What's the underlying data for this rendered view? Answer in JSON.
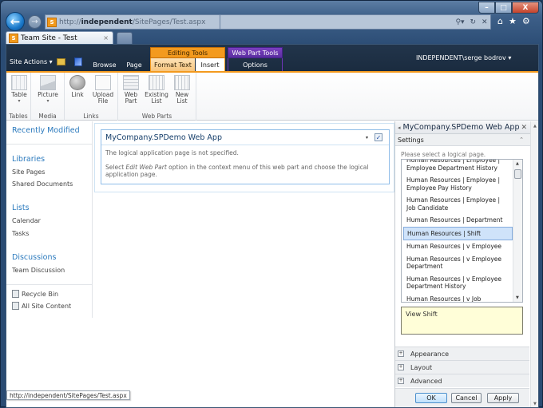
{
  "browser": {
    "url_prefix": "http://",
    "url_host": "independent",
    "url_path": "/SitePages/Test.aspx",
    "tab_title": "Team Site - Test",
    "tab_close": "×",
    "back_glyph": "←",
    "forward_glyph": "→",
    "addr_tools": [
      "⚲▾",
      "↻",
      "✕"
    ],
    "icons": {
      "home": "⌂",
      "favorites": "★",
      "tools": "⚙"
    },
    "window_controls": {
      "minimize": "–",
      "maximize": "□",
      "close": "X"
    },
    "status_url": "http://independent/SitePages/Test.aspx"
  },
  "ribbon": {
    "site_actions": "Site Actions ▾",
    "tabs": {
      "browse": "Browse",
      "page": "Page",
      "format_text": "Format Text",
      "insert": "Insert",
      "options": "Options"
    },
    "context_groups": {
      "editing_tools": "Editing Tools",
      "web_part_tools": "Web Part Tools"
    },
    "user": "INDEPENDENT\\serge bodrov ▾",
    "groups": [
      {
        "label": "Tables",
        "buttons": [
          {
            "label": "Table",
            "caret": "▾"
          }
        ]
      },
      {
        "label": "Media",
        "buttons": [
          {
            "label": "Picture",
            "caret": "▾"
          }
        ]
      },
      {
        "label": "Links",
        "buttons": [
          {
            "label": "Link"
          },
          {
            "label_1": "Upload",
            "label_2": "File"
          }
        ]
      },
      {
        "label": "Web Parts",
        "buttons": [
          {
            "label_1": "Web",
            "label_2": "Part"
          },
          {
            "label_1": "Existing",
            "label_2": "List"
          },
          {
            "label_1": "New",
            "label_2": "List"
          }
        ]
      }
    ]
  },
  "leftnav": {
    "recently_modified": "Recently Modified",
    "libraries": {
      "heading": "Libraries",
      "items": [
        "Site Pages",
        "Shared Documents"
      ]
    },
    "lists": {
      "heading": "Lists",
      "items": [
        "Calendar",
        "Tasks"
      ]
    },
    "discussions": {
      "heading": "Discussions",
      "items": [
        "Team Discussion"
      ]
    },
    "footer": [
      "Recycle Bin",
      "All Site Content"
    ]
  },
  "webpart": {
    "title": "MyCompany.SPDemo Web App",
    "menu_glyph": "▾",
    "check_glyph": "✓",
    "message": "The logical application page is not specified.",
    "instruction_pre": "Select ",
    "instruction_em": "Edit Web Part",
    "instruction_post": " option in the context menu of this web part and choose the logical application page."
  },
  "toolpane": {
    "title": "MyCompany.SPDemo Web App",
    "back_glyph": "◂",
    "close_glyph": "✕",
    "settings": "Settings",
    "collapse_glyph": "⌃",
    "prompt": "Please select a logical page.",
    "pages": [
      "Human Resources | Employee | Employee Department History",
      "Human Resources | Employee | Employee Pay History",
      "Human Resources | Employee | Job Candidate",
      "Human Resources | Department",
      "Human Resources | Shift",
      "Human Resources | v Employee",
      "Human Resources | v Employee Department",
      "Human Resources | v Employee Department History",
      "Human Resources | v Job Candidate"
    ],
    "selected_page": "Human Resources | Shift",
    "description": "View Shift",
    "sections": [
      "Appearance",
      "Layout",
      "Advanced"
    ],
    "buttons": {
      "ok": "OK",
      "cancel": "Cancel",
      "apply": "Apply"
    }
  }
}
